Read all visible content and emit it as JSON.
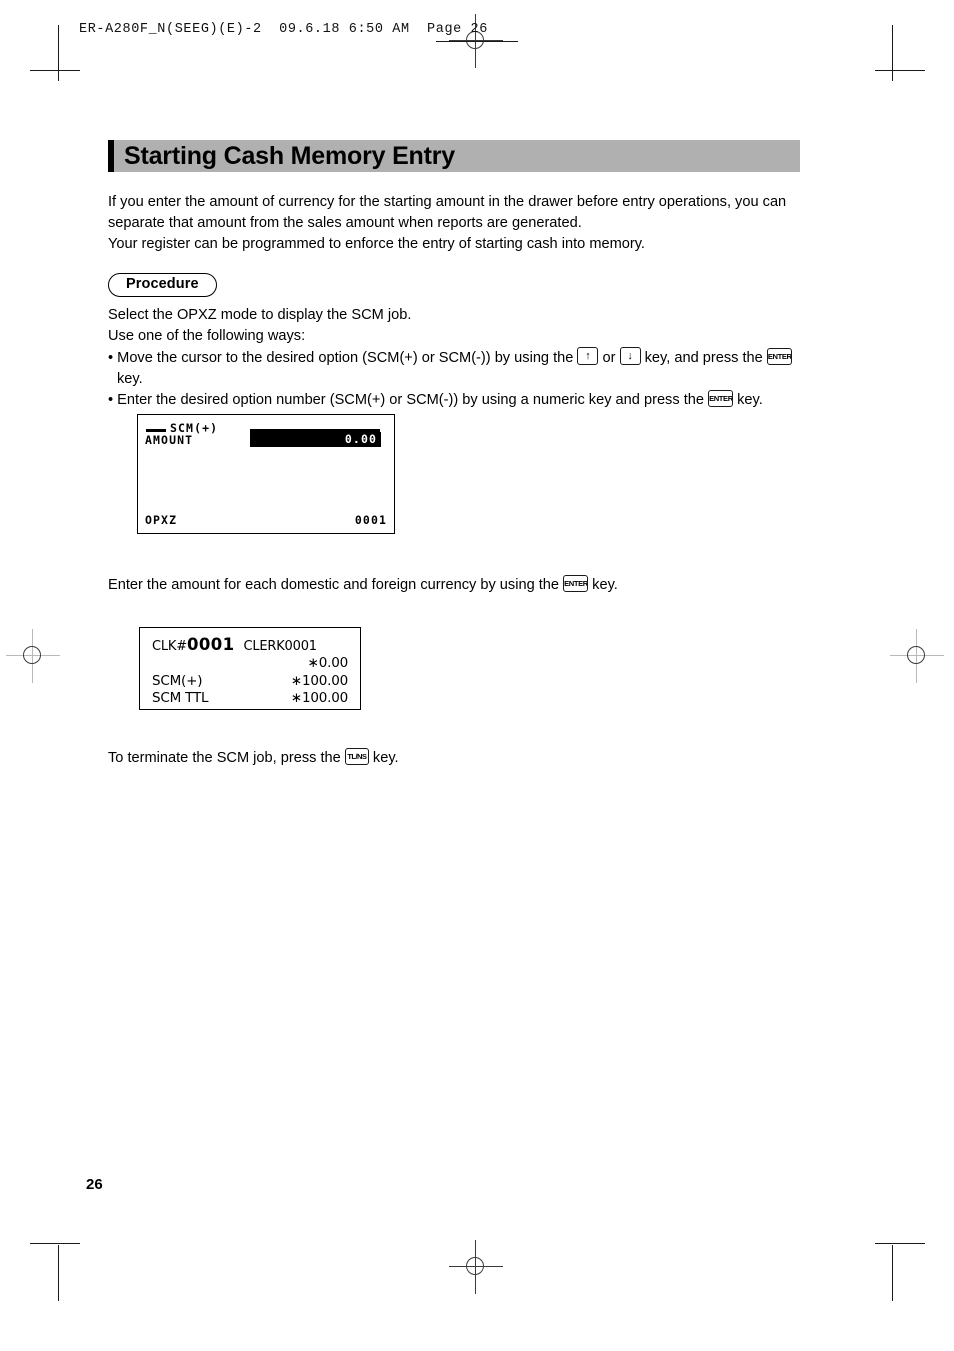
{
  "running_head": {
    "text": "ER-A280F_N(SEEG)(E)-2  09.6.18 6:50 AM  Page 26"
  },
  "title": "Starting Cash Memory Entry",
  "intro": {
    "line1": "If you enter the amount of currency for the starting amount in the drawer before entry operations, you can",
    "line2": "separate that amount from the sales amount when reports are generated.",
    "line3": "Your register can be programmed to enforce the entry of starting cash into memory."
  },
  "procedure_label": "Procedure",
  "steps": {
    "line1": "Select the OPXZ mode to display the SCM job.",
    "line2": "Use one of the following ways:",
    "bullet1_a": "• Move the cursor to the desired option (SCM(+) or SCM(-)) by using the",
    "bullet1_b": "or",
    "bullet1_c": "key, and press the",
    "bullet1_d": "key.",
    "bullet2_a": "• Enter the desired option number (SCM(+) or SCM(-)) by using a numeric key and press the",
    "bullet2_b": "key."
  },
  "keys": {
    "up": "↑",
    "down": "↓",
    "enter": "ENTER",
    "tlns": "TL/NS"
  },
  "lcd": {
    "title": "SCM(+)",
    "label": "AMOUNT",
    "field_value": "0.00",
    "mode": "OPXZ",
    "number": "0001"
  },
  "note_enter": {
    "a": "Enter the amount for each domestic and foreign currency by using the",
    "b": "key."
  },
  "receipt": {
    "clk_prefix": "CLK#",
    "clk_number": "0001",
    "clerk": "CLERK0001",
    "row2_amount": "∗0.00",
    "row3_label": "SCM(+)",
    "row3_amount": "∗100.00",
    "row4_label": "SCM TTL",
    "row4_amount": "∗100.00"
  },
  "note_terminate": {
    "a": "To terminate the SCM job, press the",
    "b": "key."
  },
  "page_number": "26"
}
